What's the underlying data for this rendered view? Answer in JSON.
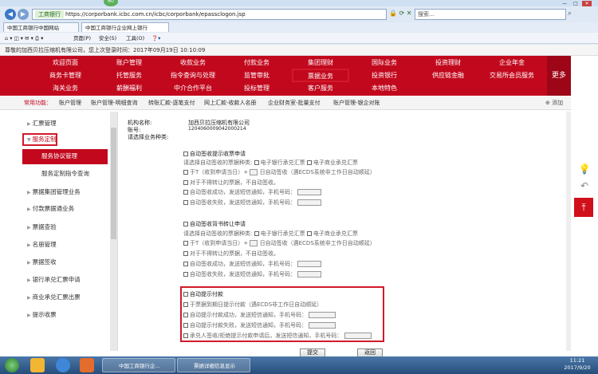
{
  "browser": {
    "badge": "60",
    "address_site": "工商银行",
    "address_url": "https://corporbank.icbc.com.cn/icbc/corporbank/epassclogon.jsp",
    "search_placeholder": "搜索...",
    "tabs": [
      "中国工商银行中国网站",
      "中国工商银行企业网上银行"
    ],
    "cmds": [
      "页面(P)",
      "安全(S)",
      "工具(O)"
    ]
  },
  "greeting": "尊敬的加西贝拉压缩机有限公司，您上次登录时间：2017年09月19日 10:10:09",
  "menu": {
    "row1": [
      "欢迎页面",
      "账户管理",
      "收款业务",
      "付款业务",
      "集团理财",
      "国际业务",
      "投资理财",
      "企业年金"
    ],
    "row2": [
      "商务卡管理",
      "托管服务",
      "指令查询与处理",
      "监管审批",
      "票据业务",
      "投资银行",
      "供应链金融",
      "交易所会员服务"
    ],
    "row3": [
      "海关业务",
      "薪酬福利",
      "中介合作平台",
      "投标管理",
      "客户服务",
      "本地特色"
    ],
    "more": "更多"
  },
  "quick": {
    "label": "常用功能：",
    "items": [
      "账户管理",
      "账户管理-明细查询",
      "转账汇款-逐笔支付",
      "网上汇款-收款人名册",
      "企业财务室-批量支付",
      "账户管理-银企对账"
    ],
    "add": "添加"
  },
  "sidebar": {
    "items": [
      "汇票管理",
      "服务定制",
      "服务协议管理",
      "服务定制指令查询",
      "票据集团管理业务",
      "付款票据通业务",
      "票据查验",
      "名册管理",
      "票据签收",
      "银行承兑汇票申请",
      "商业承兑汇票出票",
      "提示收票"
    ]
  },
  "form": {
    "org_label": "机构名称:",
    "org_value": "加西贝拉压缩机有限公司",
    "acct_label": "账号:",
    "acct_value": "1204060009042000214",
    "type_label": "请选择业务种类:",
    "s1": {
      "title": "自动签收提示收票申请",
      "kinds_label": "请选择自动签收的票据种类:",
      "kind1": "电子银行承兑汇票",
      "kind2": "电子商业承兑汇票",
      "at_label": "于T（收到申请当日）+",
      "at_suffix": "日自动签收（遇ECDS系统非工作日自动顺延）",
      "no_transfer": "对于不得转让的票据，不自动签收。",
      "ok_notify": "自动签收成功，发送短信通知，手机号码：",
      "fail_notify": "自动签收失败，发送短信通知，手机号码："
    },
    "s2": {
      "title": "自动签收背书转让申请",
      "kinds_label": "请选择自动签收的票据种类:",
      "kind1": "电子银行承兑汇票",
      "kind2": "电子商业承兑汇票",
      "at_label": "于T（收到申请当日）+",
      "at_suffix": "日自动签收（遇ECDS系统非工作日自动顺延）",
      "no_transfer": "对于不得转让的票据，不自动签收。",
      "ok_notify": "自动签收成功，发送短信通知，手机号码：",
      "fail_notify": "自动签收失败，发送短信通知，手机号码："
    },
    "s3": {
      "title": "自动提示付款",
      "l1": "于票据到期日提示付款（遇ECDS非工作日自动顺延）",
      "l2": "自动提示付款成功，发送短信通知，手机号码：",
      "l3": "自动提示付款失败，发送短信通知，手机号码：",
      "l4": "承兑人签收/拒绝提示付款申请后，发送短信通知，手机号码："
    },
    "submit": "提交",
    "back": "返回"
  },
  "taskbar": {
    "tasks": [
      "中国工商银行企...",
      "票据详细信息显示"
    ],
    "time": "11:21",
    "date": "2017/9/20"
  },
  "colors": {
    "brand_red": "#c2081d",
    "highlight": "#d11a2a"
  }
}
